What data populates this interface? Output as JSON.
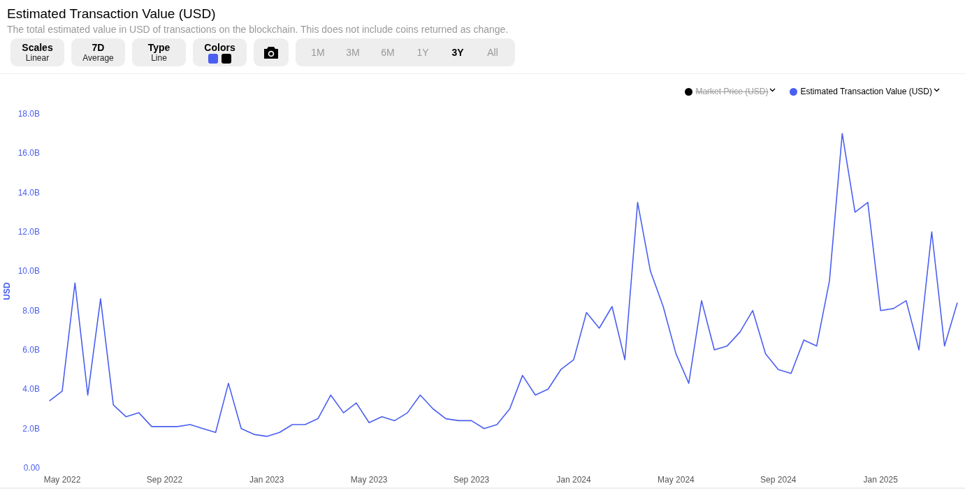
{
  "title": "Estimated Transaction Value (USD)",
  "subtitle": "The total estimated value in USD of transactions on the blockchain. This does not include coins returned as change.",
  "controls": [
    {
      "kind": "option",
      "label": "Scales",
      "value": "Linear"
    },
    {
      "kind": "option",
      "label": "7D",
      "value": "Average"
    },
    {
      "kind": "option",
      "label": "Type",
      "value": "Line"
    },
    {
      "kind": "colors",
      "label": "Colors",
      "swatches": [
        {
          "color": "#4a5ff0"
        },
        {
          "color": "#000000"
        }
      ]
    },
    {
      "kind": "camera"
    }
  ],
  "ranges": [
    {
      "label": "1M",
      "selected": false
    },
    {
      "label": "3M",
      "selected": false
    },
    {
      "label": "6M",
      "selected": false
    },
    {
      "label": "1Y",
      "selected": false
    },
    {
      "label": "3Y",
      "selected": true
    },
    {
      "label": "All",
      "selected": false
    }
  ],
  "legend": [
    {
      "label": "Market Price (USD)",
      "color": "#000000",
      "visible": false
    }
  ],
  "chart_data": {
    "type": "line",
    "ylabel": "USD",
    "categories": [
      null,
      "May 2022",
      null,
      null,
      null,
      null,
      null,
      null,
      null,
      "Sep 2022",
      null,
      null,
      null,
      null,
      null,
      null,
      null,
      "Jan 2023",
      null,
      null,
      null,
      null,
      null,
      null,
      null,
      "May 2023",
      null,
      null,
      null,
      null,
      null,
      null,
      null,
      "Sep 2023",
      null,
      null,
      null,
      null,
      null,
      null,
      null,
      "Jan 2024",
      null,
      null,
      null,
      null,
      null,
      null,
      null,
      "May 2024",
      null,
      null,
      null,
      null,
      null,
      null,
      null,
      "Sep 2024",
      null,
      null,
      null,
      null,
      null,
      null,
      null,
      "Jan 2025",
      null,
      null,
      null,
      null,
      null,
      null
    ],
    "series": [
      {
        "name": "Estimated Transaction Value (USD)",
        "color": "#4a5ff0",
        "values": [
          3.4,
          3.9,
          9.4,
          3.7,
          8.6,
          3.2,
          2.6,
          2.8,
          2.1,
          2.1,
          2.1,
          2.2,
          2,
          1.8,
          4.3,
          2,
          1.7,
          1.6,
          1.8,
          2.2,
          2.2,
          2.5,
          3.7,
          2.8,
          3.3,
          2.3,
          2.6,
          2.4,
          2.8,
          3.7,
          3,
          2.5,
          2.4,
          2.4,
          2,
          2.2,
          3,
          4.7,
          3.7,
          4,
          5,
          5.5,
          7.9,
          7.1,
          8.2,
          5.5,
          13.5,
          10,
          8.2,
          5.8,
          4.3,
          8.5,
          6,
          6.2,
          6.9,
          8,
          5.8,
          5,
          4.8,
          6.5,
          6.2,
          9.5,
          17,
          13,
          13.5,
          8,
          8.1,
          8.5,
          6,
          12,
          6.2,
          8.4
        ]
      }
    ],
    "ylim": [
      0,
      18
    ],
    "yticks": [
      {
        "value": 0,
        "label": "0.00"
      },
      {
        "value": 2,
        "label": "2.0B"
      },
      {
        "value": 4,
        "label": "4.0B"
      },
      {
        "value": 6,
        "label": "6.0B"
      },
      {
        "value": 8,
        "label": "8.0B"
      },
      {
        "value": 10,
        "label": "10.0B"
      },
      {
        "value": 12,
        "label": "12.0B"
      },
      {
        "value": 14,
        "label": "14.0B"
      },
      {
        "value": 16,
        "label": "16.0B"
      },
      {
        "value": 18,
        "label": "18.0B"
      }
    ]
  }
}
